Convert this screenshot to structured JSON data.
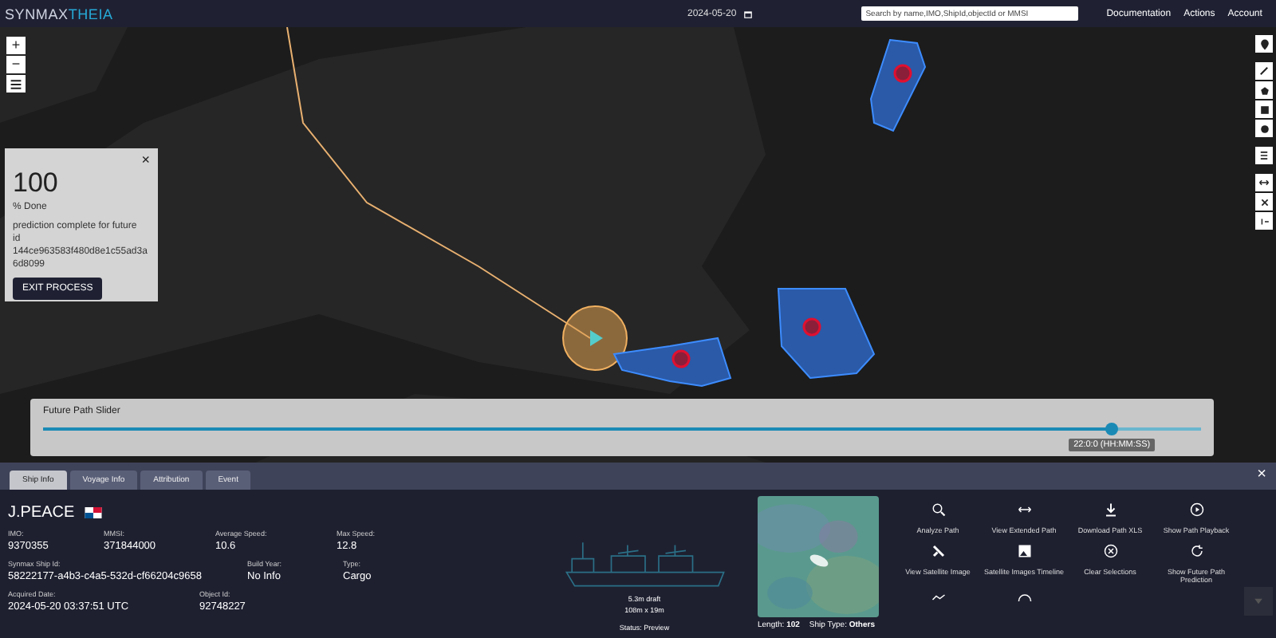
{
  "header": {
    "logo": "SYNMAX",
    "logo_accent": "THEIA",
    "date": "2024-05-20",
    "search": {
      "placeholder": "Search by name,IMO,ShipId,objectId or MMSI"
    },
    "nav": [
      "Documentation",
      "Actions",
      "Account"
    ]
  },
  "zoom_controls": [
    "+",
    "−"
  ],
  "progress_card": {
    "value": "100",
    "unit": "% Done",
    "message": "prediction complete for future id",
    "id": "144ce963583f480d8e1c55ad3a6d8099",
    "button": "EXIT PROCESS",
    "close": "×"
  },
  "slider": {
    "label": "Future Path Slider",
    "level": 0.923,
    "tooltip": "22:0:0 (HH:MM:SS)"
  },
  "tabs": [
    {
      "label": "Ship Info",
      "selected": true
    },
    {
      "label": "Voyage Info",
      "selected": false
    },
    {
      "label": "Attribution",
      "selected": false
    },
    {
      "label": "Event",
      "selected": false
    }
  ],
  "panel_close": "×",
  "ship": {
    "name": "J.PEACE",
    "detail_groups": [
      {
        "fields": [
          {
            "label": "IMO:",
            "value": "9370355"
          },
          {
            "label": "MMSI:",
            "value": "371844000"
          },
          {
            "label": "Average Speed:",
            "value": "10.6"
          },
          {
            "label": "Max Speed:",
            "value": "12.8"
          }
        ]
      },
      {
        "fields": [
          {
            "label": "Synmax Ship Id:",
            "value": "58222177-a4b3-c4a5-532d-cf66204c9658"
          },
          {
            "label": "Build Year:",
            "value": "No Info"
          },
          {
            "label": "Type:",
            "value": "Cargo"
          }
        ]
      },
      {
        "fields": [
          {
            "label": "Acquired Date:",
            "value": "2024-05-20 03:37:51 UTC"
          },
          {
            "label": "Object Id:",
            "value": "92748227"
          }
        ]
      }
    ],
    "draft": "5.3m draft",
    "dimensions": "108m x 19m",
    "status": "Status: Preview"
  },
  "image_caption": [
    "Length: **102**",
    "Ship Type: **Others**"
  ],
  "actions": [
    {
      "label": "Analyze Path"
    },
    {
      "label": "View Extended Path"
    },
    {
      "label": "Download Path XLS"
    },
    {
      "label": "Show Path Playback"
    },
    {
      "label": "View Satellite Image"
    },
    {
      "label": "Satellite Images Timeline"
    },
    {
      "label": "Clear Selections"
    },
    {
      "label": "Show Future Path Prediction"
    }
  ]
}
